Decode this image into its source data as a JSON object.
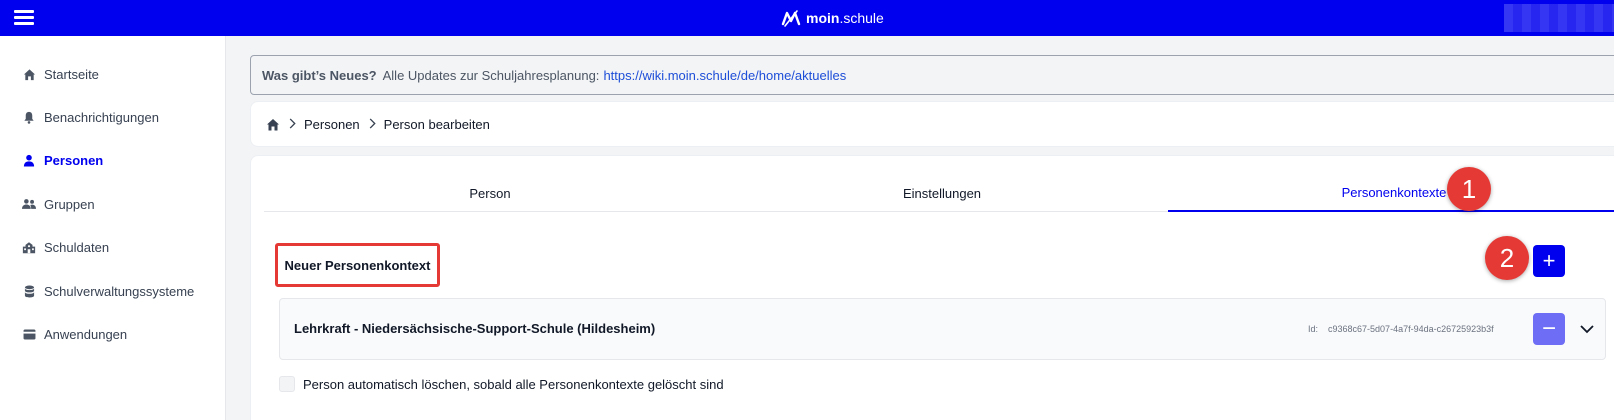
{
  "app": {
    "logo_bold": "moin",
    "logo_rest": ".schule"
  },
  "sidebar": {
    "items": [
      {
        "label": "Startseite",
        "icon": "home-icon",
        "active": false
      },
      {
        "label": "Benachrichtigungen",
        "icon": "bell-icon",
        "active": false
      },
      {
        "label": "Personen",
        "icon": "person-icon",
        "active": true
      },
      {
        "label": "Gruppen",
        "icon": "group-icon",
        "active": false
      },
      {
        "label": "Schuldaten",
        "icon": "school-icon",
        "active": false
      },
      {
        "label": "Schulverwaltungssysteme",
        "icon": "database-icon",
        "active": false
      },
      {
        "label": "Anwendungen",
        "icon": "card-icon",
        "active": false
      }
    ]
  },
  "banner": {
    "heading": "Was gibt’s Neues?",
    "text": "Alle Updates zur Schuljahresplanung:",
    "link": "https://wiki.moin.schule/de/home/aktuelles"
  },
  "breadcrumb": {
    "items": [
      "Personen",
      "Person bearbeiten"
    ]
  },
  "tabs": [
    {
      "label": "Person",
      "active": false
    },
    {
      "label": "Einstellungen",
      "active": false
    },
    {
      "label": "Personenkontexte",
      "active": true
    }
  ],
  "markers": [
    "1",
    "2"
  ],
  "new_context": {
    "label": "Neuer Personenkontext",
    "add_symbol": "+"
  },
  "context": {
    "title": "Lehrkraft - Niedersächsische-Support-Schule (Hildesheim)",
    "id_label": "Id:",
    "id_value": "c9368c67-5d07-4a7f-94da-c26725923b3f",
    "remove_symbol": "−"
  },
  "auto_delete": {
    "label": "Person automatisch löschen, sobald alle Personenkontexte gelöscht sind",
    "checked": false
  },
  "colors": {
    "brand": "#0000ee",
    "marker": "#e53935"
  }
}
